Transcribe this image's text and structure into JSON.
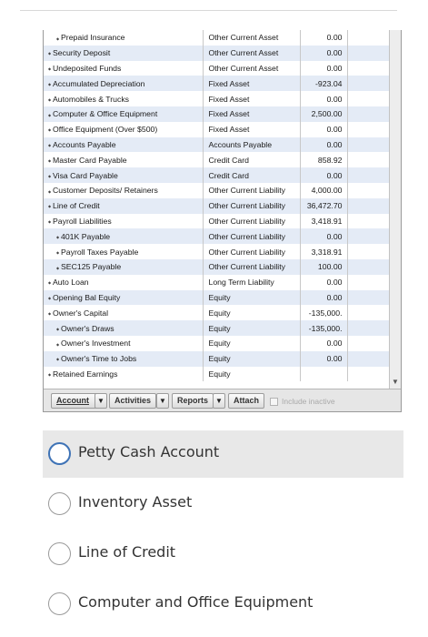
{
  "accounts": [
    {
      "name": "Prepaid Insurance",
      "type": "Other Current Asset",
      "balance": "0.00",
      "indent": 1
    },
    {
      "name": "Security Deposit",
      "type": "Other Current Asset",
      "balance": "0.00",
      "indent": 0
    },
    {
      "name": "Undeposited Funds",
      "type": "Other Current Asset",
      "balance": "0.00",
      "indent": 0
    },
    {
      "name": "Accumulated Depreciation",
      "type": "Fixed Asset",
      "balance": "-923.04",
      "indent": 0
    },
    {
      "name": "Automobiles & Trucks",
      "type": "Fixed Asset",
      "balance": "0.00",
      "indent": 0
    },
    {
      "name": "Computer & Office Equipment",
      "type": "Fixed Asset",
      "balance": "2,500.00",
      "indent": 0
    },
    {
      "name": "Office Equipment (Over $500)",
      "type": "Fixed Asset",
      "balance": "0.00",
      "indent": 0
    },
    {
      "name": "Accounts Payable",
      "type": "Accounts Payable",
      "balance": "0.00",
      "indent": 0
    },
    {
      "name": "Master Card Payable",
      "type": "Credit Card",
      "balance": "858.92",
      "indent": 0
    },
    {
      "name": "Visa Card Payable",
      "type": "Credit Card",
      "balance": "0.00",
      "indent": 0
    },
    {
      "name": "Customer Deposits/ Retainers",
      "type": "Other Current Liability",
      "balance": "4,000.00",
      "indent": 0
    },
    {
      "name": "Line of Credit",
      "type": "Other Current Liability",
      "balance": "36,472.70",
      "indent": 0
    },
    {
      "name": "Payroll Liabilities",
      "type": "Other Current Liability",
      "balance": "3,418.91",
      "indent": 0
    },
    {
      "name": "401K Payable",
      "type": "Other Current Liability",
      "balance": "0.00",
      "indent": 1
    },
    {
      "name": "Payroll Taxes Payable",
      "type": "Other Current Liability",
      "balance": "3,318.91",
      "indent": 1
    },
    {
      "name": "SEC125 Payable",
      "type": "Other Current Liability",
      "balance": "100.00",
      "indent": 1
    },
    {
      "name": "Auto Loan",
      "type": "Long Term Liability",
      "balance": "0.00",
      "indent": 0
    },
    {
      "name": "Opening Bal Equity",
      "type": "Equity",
      "balance": "0.00",
      "indent": 0
    },
    {
      "name": "Owner's Capital",
      "type": "Equity",
      "balance": "-135,000.",
      "indent": 0
    },
    {
      "name": "Owner's Draws",
      "type": "Equity",
      "balance": "-135,000.",
      "indent": 1
    },
    {
      "name": "Owner's  Investment",
      "type": "Equity",
      "balance": "0.00",
      "indent": 1
    },
    {
      "name": "Owner's Time to Jobs",
      "type": "Equity",
      "balance": "0.00",
      "indent": 1
    },
    {
      "name": "Retained Earnings",
      "type": "Equity",
      "balance": "",
      "indent": 0
    }
  ],
  "toolbar": {
    "account_label": "Account",
    "activities_label": "Activities",
    "reports_label": "Reports",
    "attach_label": "Attach",
    "include_inactive_label": "Include inactive",
    "dropdown_glyph": "▼",
    "include_inactive_checked": false
  },
  "scrollbar": {
    "down_arrow": "▼"
  },
  "options": [
    {
      "label": "Petty Cash Account",
      "selected": true
    },
    {
      "label": "Inventory Asset",
      "selected": false
    },
    {
      "label": "Line of Credit",
      "selected": false
    },
    {
      "label": "Computer and Office Equipment",
      "selected": false
    }
  ],
  "colors": {
    "selected_radio": "#3f73b6",
    "row_alt": "#e4ebf6",
    "selected_option_bg": "#e8e8e8"
  }
}
